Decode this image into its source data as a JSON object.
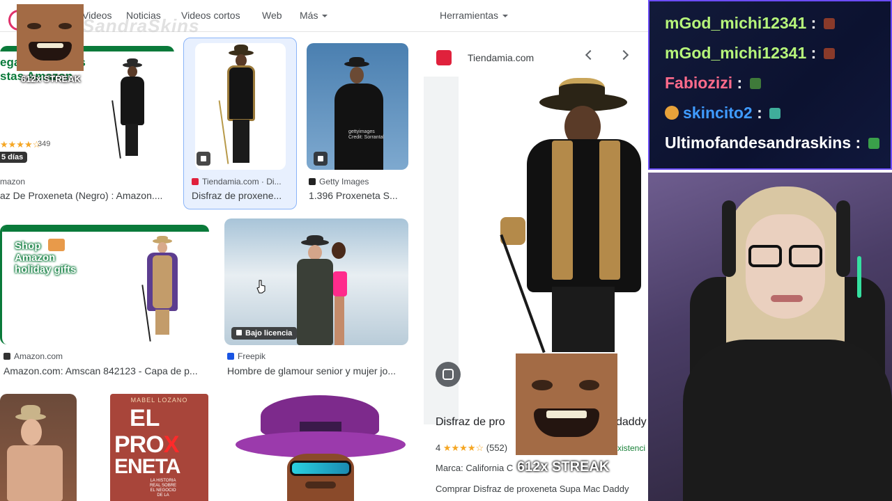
{
  "nav": {
    "tabs": [
      "Videos",
      "Noticias",
      "Videos cortos",
      "Web"
    ],
    "more": "Más",
    "tools": "Herramientas"
  },
  "overlay_watermark": "SandraSkins",
  "results": [
    {
      "source": "mazon",
      "title": "az De Proxeneta (Negro) : Amazon....",
      "rating": "★★★★☆",
      "reviews": "349",
      "badge": "5 días",
      "banner": "egalos para las\nstas Amazon"
    },
    {
      "source": "Tiendamia.com · Di...",
      "title": "Disfraz de proxene...",
      "fav_color": "#e0213c"
    },
    {
      "source": "Getty Images",
      "title": "1.396 Proxeneta S...",
      "fav_color": "#222222",
      "wm": "gettyimages\nCredit: Sorrantal"
    },
    {
      "source": "Amazon.com",
      "title": "Amazon.com: Amscan 842123 - Capa de p...",
      "banner": "Shop\nAmazon\nholiday gifts"
    },
    {
      "source": "Freepik",
      "title": "Hombre de glamour senior y mujer jo...",
      "badge": "Bajo licencia",
      "fav_color": "#1a55e3"
    },
    {
      "book_author": "MABEL LOZANO",
      "book_title_a": "EL",
      "book_title_b": "PRO",
      "book_title_c": "X",
      "book_title_d": "ENETA",
      "book_sub": "LA HISTORIA REAL SOBRE EL NEGOCIO DE LA"
    }
  ],
  "panel": {
    "site": "Tiendamia.com",
    "title_left": "Disfraz de pro",
    "title_right": "daddy",
    "rating": "4",
    "stars": "★★★★☆",
    "reviews": "(552)",
    "extra": "xistenci",
    "brand_label": "Marca: California C",
    "cta": "Comprar Disfraz de proxeneta Supa Mac Daddy"
  },
  "chat": [
    {
      "user": "mGod_michi12341",
      "color": "#b6f57a",
      "emote": "#8a3a2a"
    },
    {
      "user": "mGod_michi12341",
      "color": "#b6f57a",
      "emote": "#8a3a2a"
    },
    {
      "user": "Fabiozizi",
      "color": "#ff6b8b",
      "emote": "#3f7a3a"
    },
    {
      "user": "skincito2",
      "color": "#3f9bff",
      "emote": "#3fae9b"
    },
    {
      "user": "Ultimofandesandraskins",
      "color": "#ffffff",
      "emote": "#3aa04a"
    }
  ],
  "streak_small": "612x STREAK",
  "streak_large": "612x STREAK",
  "colors": {
    "accent": "#6b4cff",
    "chat_bg": "#0c1230",
    "amazon_green": "#0a7a3a"
  }
}
